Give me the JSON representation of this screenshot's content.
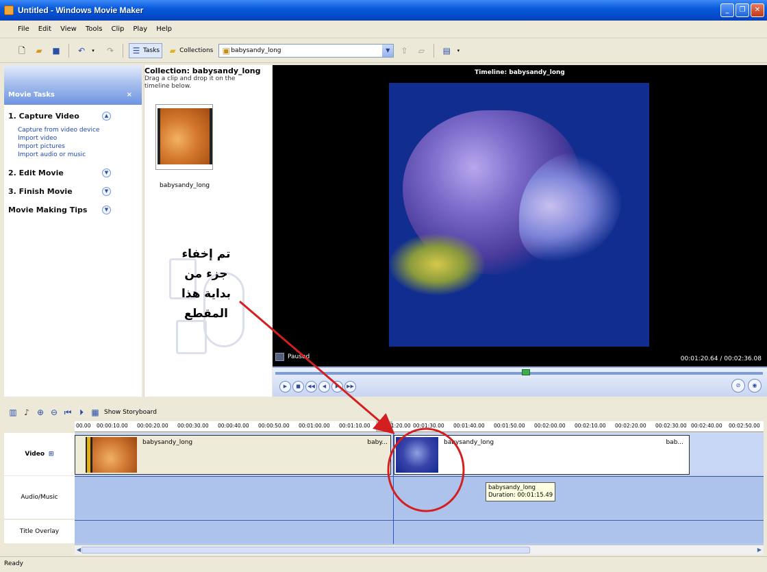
{
  "window": {
    "title": "Untitled - Windows Movie Maker"
  },
  "menu": [
    "File",
    "Edit",
    "View",
    "Tools",
    "Clip",
    "Play",
    "Help"
  ],
  "toolbar": {
    "tasks": "Tasks",
    "collections": "Collections",
    "collection_value": "babysandy_long"
  },
  "tasks_pane": {
    "title": "Movie Tasks",
    "close": "×",
    "sections": [
      {
        "label": "1. Capture Video",
        "links": [
          "Capture from video device",
          "Import video",
          "Import pictures",
          "Import audio or music"
        ]
      },
      {
        "label": "2. Edit Movie"
      },
      {
        "label": "3. Finish Movie"
      },
      {
        "label": "Movie Making Tips"
      }
    ]
  },
  "collection": {
    "title": "Collection: babysandy_long",
    "hint": "Drag a clip and drop it on the timeline below.",
    "clip_name": "babysandy_long",
    "annotation_lines": [
      "تم إخفاء",
      "جزء من",
      "بداية هذا",
      "المقطع"
    ]
  },
  "preview": {
    "title": "Timeline: babysandy_long",
    "status": "Paused",
    "time": "00:01:20.64 / 00:02:36.08"
  },
  "timeline": {
    "show_storyboard": "Show Storyboard",
    "ruler": [
      "00.00",
      "00:00:10.00",
      "00:00:20.00",
      "00:00:30.00",
      "00:00:40.00",
      "00:00:50.00",
      "00:01:00.00",
      "00:01:10.00",
      "00:01:20.00",
      "00:01:30.00",
      "00:01:40.00",
      "00:01:50.00",
      "00:02:00.00",
      "00:02:10.00",
      "00:02:20.00",
      "00:02:30.00",
      "00:02:40.00",
      "00:02:50.00"
    ],
    "tracks": {
      "video": "Video",
      "audio": "Audio/Music",
      "title": "Title Overlay"
    },
    "clip1_label": "babysandy_long",
    "clip1_end": "baby...",
    "clip2_label": "babysandy_long",
    "clip2_end": "bab...",
    "tooltip_name": "babysandy_long",
    "tooltip_duration": "Duration: 00:01:15.49"
  },
  "status": "Ready",
  "colors": {
    "annotation": "#d31f1f",
    "accent": "#0a5bdc"
  }
}
